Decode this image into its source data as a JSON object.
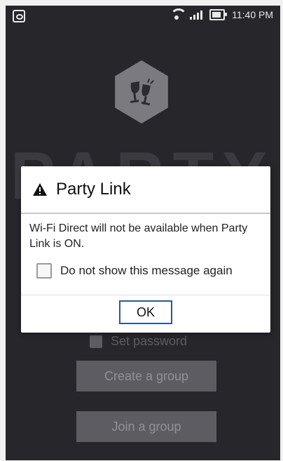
{
  "status_bar": {
    "time": "11:40 PM",
    "left_icon": "notification-icon",
    "wifi_icon": "wifi-icon",
    "signal_icon": "signal-icon",
    "battery_icon": "battery-icon"
  },
  "background": {
    "logo_icon": "champagne-glasses-icon",
    "party_text": "PARTY",
    "set_password_label": "Set password",
    "create_group_label": "Create a group",
    "join_group_label": "Join a group"
  },
  "dialog": {
    "title": "Party Link",
    "title_icon": "warning-icon",
    "message": "Wi-Fi Direct will not be available when Party Link is ON.",
    "checkbox_label": "Do not show this message again",
    "checkbox_checked": false,
    "ok_label": "OK"
  },
  "colors": {
    "app_background": "#26262b",
    "dialog_background": "#ffffff",
    "ok_border": "#2a5b8d"
  }
}
